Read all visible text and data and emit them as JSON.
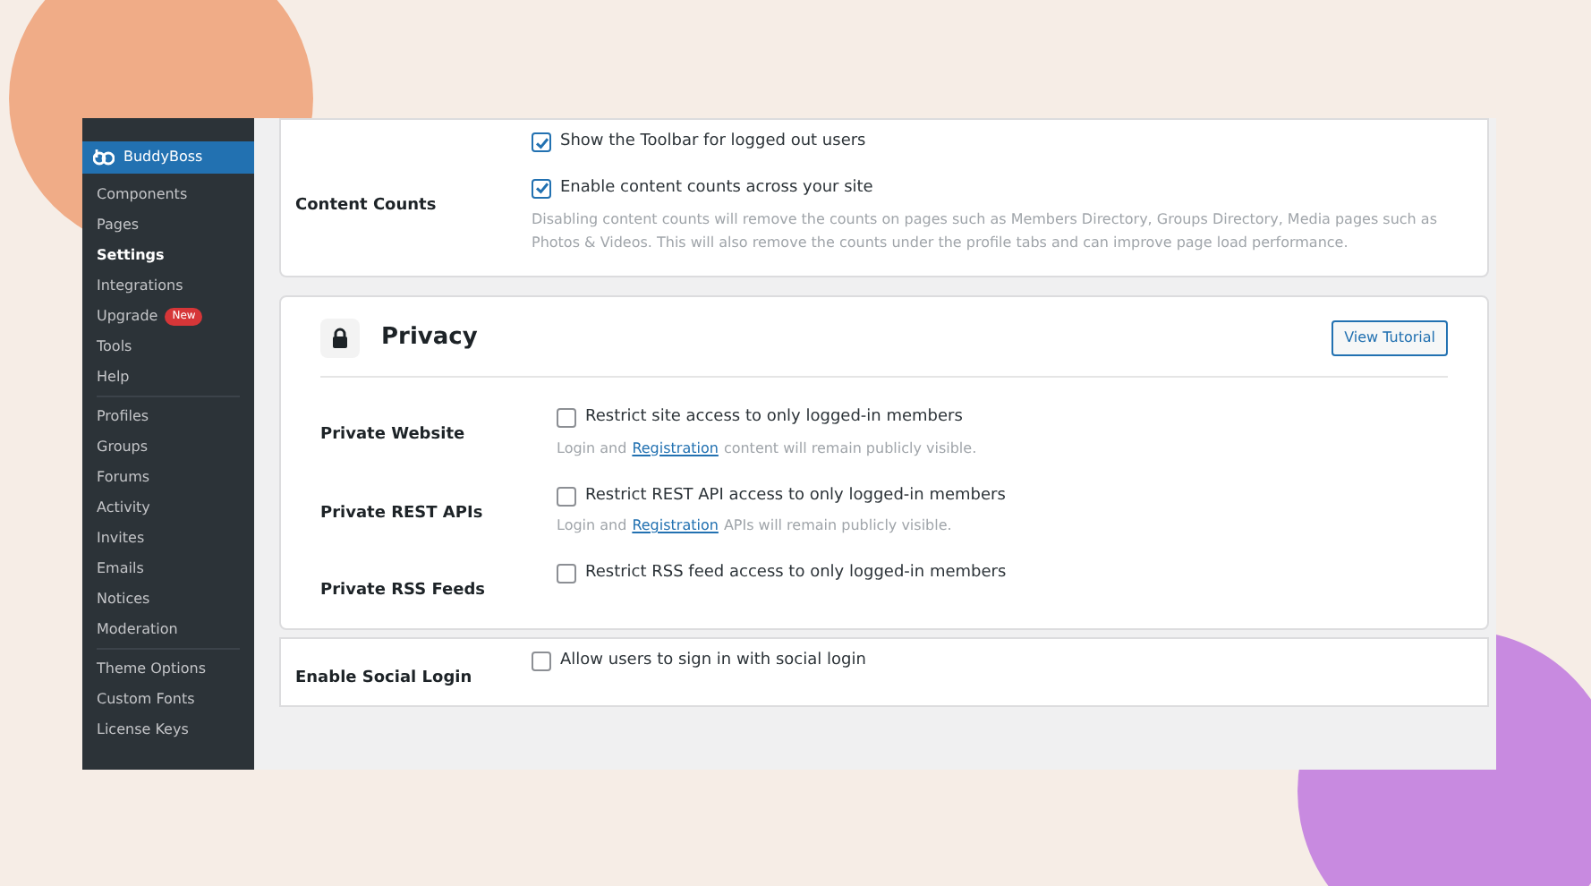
{
  "sidebar": {
    "brand": "BuddyBoss",
    "groups": [
      [
        {
          "label": "Components",
          "selected": false
        },
        {
          "label": "Pages",
          "selected": false
        },
        {
          "label": "Settings",
          "selected": true
        },
        {
          "label": "Integrations",
          "selected": false
        },
        {
          "label": "Upgrade",
          "selected": false,
          "badge": "New"
        },
        {
          "label": "Tools",
          "selected": false
        },
        {
          "label": "Help",
          "selected": false
        }
      ],
      [
        {
          "label": "Profiles",
          "selected": false
        },
        {
          "label": "Groups",
          "selected": false
        },
        {
          "label": "Forums",
          "selected": false
        },
        {
          "label": "Activity",
          "selected": false
        },
        {
          "label": "Invites",
          "selected": false
        },
        {
          "label": "Emails",
          "selected": false
        },
        {
          "label": "Notices",
          "selected": false
        },
        {
          "label": "Moderation",
          "selected": false
        }
      ],
      [
        {
          "label": "Theme Options",
          "selected": false
        },
        {
          "label": "Custom Fonts",
          "selected": false
        },
        {
          "label": "License Keys",
          "selected": false
        }
      ]
    ]
  },
  "toolbar_card": {
    "rows": [
      {
        "checked": true,
        "text": "Show the Toolbar for logged out users"
      },
      {
        "label": "Content Counts",
        "checked": true,
        "text": "Enable content counts across your site",
        "description": "Disabling content counts will remove the counts on pages such as Members Directory, Groups Directory, Media pages such as Photos & Videos. This will also remove the counts under the profile tabs and can improve page load performance."
      }
    ]
  },
  "privacy_card": {
    "title": "Privacy",
    "button": "View Tutorial",
    "rows": [
      {
        "label": "Private Website",
        "checked": false,
        "text": "Restrict site access to only logged-in members",
        "note": {
          "before": "Login and",
          "link": "Registration",
          "after": "content will remain publicly visible."
        }
      },
      {
        "label": "Private REST APIs",
        "checked": false,
        "text": "Restrict REST API access to only logged-in members",
        "note": {
          "before": "Login and",
          "link": "Registration",
          "after": "APIs will remain publicly visible."
        }
      },
      {
        "label": "Private RSS Feeds",
        "checked": false,
        "text": "Restrict RSS feed access to only logged-in members"
      }
    ]
  },
  "social_card": {
    "rows": [
      {
        "label": "Enable Social Login",
        "checked": false,
        "text": "Allow users to sign in with social login"
      }
    ]
  }
}
